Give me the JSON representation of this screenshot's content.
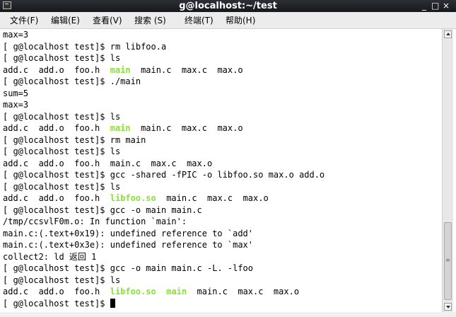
{
  "window": {
    "title": "g@localhost:~/test",
    "minimize_icon": "_",
    "maximize_icon": "□",
    "close_icon": "×"
  },
  "menu": [
    {
      "label": "文件(F)"
    },
    {
      "label": "编辑(E)"
    },
    {
      "label": "查看(V)"
    },
    {
      "label": "搜索 (S)"
    },
    {
      "label": "终端(T)"
    },
    {
      "label": "帮助(H)"
    }
  ],
  "terminal": {
    "lines": [
      [
        {
          "text": "max=3"
        }
      ],
      [
        {
          "text": "[ g@localhost test]$ rm libfoo.a"
        }
      ],
      [
        {
          "text": "[ g@localhost test]$ ls"
        }
      ],
      [
        {
          "text": "add.c  add.o  foo.h  "
        },
        {
          "text": "main",
          "cls": "exec"
        },
        {
          "text": "  main.c  max.c  max.o"
        }
      ],
      [
        {
          "text": "[ g@localhost test]$ ./main"
        }
      ],
      [
        {
          "text": "sum=5"
        }
      ],
      [
        {
          "text": "max=3"
        }
      ],
      [
        {
          "text": "[ g@localhost test]$ ls"
        }
      ],
      [
        {
          "text": "add.c  add.o  foo.h  "
        },
        {
          "text": "main",
          "cls": "exec"
        },
        {
          "text": "  main.c  max.c  max.o"
        }
      ],
      [
        {
          "text": "[ g@localhost test]$ rm main"
        }
      ],
      [
        {
          "text": "[ g@localhost test]$ ls"
        }
      ],
      [
        {
          "text": "add.c  add.o  foo.h  main.c  max.c  max.o"
        }
      ],
      [
        {
          "text": "[ g@localhost test]$ gcc -shared -fPIC -o libfoo.so max.o add.o"
        }
      ],
      [
        {
          "text": "[ g@localhost test]$ ls"
        }
      ],
      [
        {
          "text": "add.c  add.o  foo.h  "
        },
        {
          "text": "libfoo.so",
          "cls": "exec"
        },
        {
          "text": "  main.c  max.c  max.o"
        }
      ],
      [
        {
          "text": "[ g@localhost test]$ gcc -o main main.c"
        }
      ],
      [
        {
          "text": "/tmp/ccsvlF0m.o: In function `main':"
        }
      ],
      [
        {
          "text": "main.c:(.text+0x19): undefined reference to `add'"
        }
      ],
      [
        {
          "text": "main.c:(.text+0x3e): undefined reference to `max'"
        }
      ],
      [
        {
          "text": "collect2: ld 返回 1"
        }
      ],
      [
        {
          "text": "[ g@localhost test]$ gcc -o main main.c -L. -lfoo"
        }
      ],
      [
        {
          "text": "[ g@localhost test]$ ls"
        }
      ],
      [
        {
          "text": "add.c  add.o  foo.h  "
        },
        {
          "text": "libfoo.so",
          "cls": "exec"
        },
        {
          "text": "  "
        },
        {
          "text": "main",
          "cls": "exec"
        },
        {
          "text": "  main.c  max.c  max.o"
        }
      ],
      [
        {
          "text": "[ g@localhost test]$ "
        }
      ]
    ]
  },
  "scroll": {
    "position": 0.86
  },
  "colors": {
    "executable": "#8ae234",
    "titlebar": "#1f2327",
    "menubar": "#ececec"
  }
}
